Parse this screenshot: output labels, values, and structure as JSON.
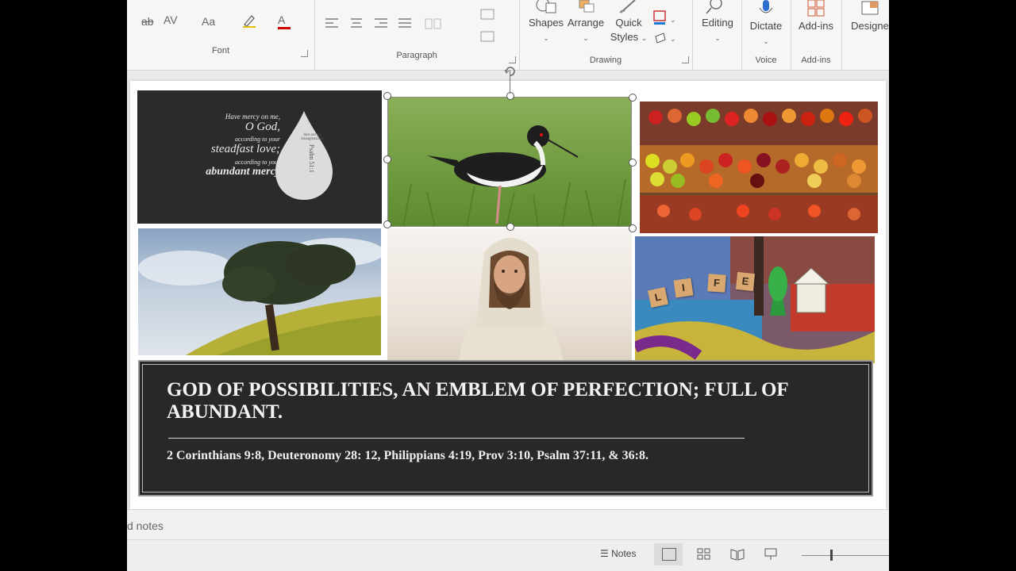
{
  "ribbon": {
    "font_group": {
      "label": "Font",
      "buttons": [
        "ab",
        "AV",
        "Aa",
        "A"
      ]
    },
    "paragraph_group": {
      "label": "Paragraph"
    },
    "drawing_group": {
      "label": "Drawing",
      "shapes_label": "Shapes",
      "arrange_label": "Arrange",
      "quick_styles_label_1": "Quick",
      "quick_styles_label_2": "Styles"
    },
    "editing_label": "Editing",
    "voice_group": {
      "label": "Voice",
      "dictate_label": "Dictate"
    },
    "addins_group": {
      "label": "Add-ins",
      "addins_label": "Add-ins"
    },
    "designer_label": "Designe"
  },
  "slide": {
    "quote": {
      "line1": "Have mercy on me,",
      "line2": "O God,",
      "line3": "according to your",
      "line4": "steadfast love;",
      "line5": "according to your",
      "line6": "abundant mercy",
      "drop_text": "blot out my transgressions.",
      "drop_ref": "Psalm 51:1"
    },
    "scrabble_tiles": [
      "L",
      "I",
      "F",
      "E"
    ],
    "banner": {
      "title": "GOD OF POSSIBILITIES, AN EMBLEM OF PERFECTION; FULL OF ABUNDANT.",
      "references": "2 Corinthians 9:8, Deuteronomy 28: 12, Philippians 4:19, Prov 3:10, Psalm 37:11, & 36:8."
    }
  },
  "notes": {
    "placeholder": "d notes"
  },
  "statusbar": {
    "notes_label": "Notes"
  }
}
